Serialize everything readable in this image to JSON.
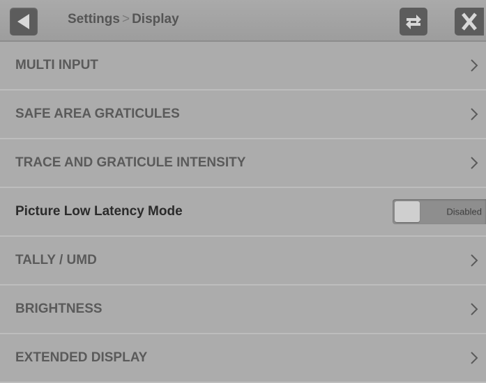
{
  "header": {
    "breadcrumb_parent": "Settings",
    "breadcrumb_separator": ">",
    "breadcrumb_current": "Display",
    "back_icon": "back-arrow-icon",
    "swap_icon": "swap-arrows-icon",
    "close_icon": "close-x-icon"
  },
  "menu": {
    "items": [
      {
        "label": "MULTI INPUT",
        "type": "submenu"
      },
      {
        "label": "SAFE AREA GRATICULES",
        "type": "submenu"
      },
      {
        "label": "TRACE AND GRATICULE INTENSITY",
        "type": "submenu"
      },
      {
        "label": "Picture Low Latency Mode",
        "type": "toggle",
        "state": "Disabled"
      },
      {
        "label": "TALLY / UMD",
        "type": "submenu"
      },
      {
        "label": "BRIGHTNESS",
        "type": "submenu"
      },
      {
        "label": "EXTENDED DISPLAY",
        "type": "submenu"
      }
    ]
  },
  "colors": {
    "background": "#acacac",
    "button": "#5c5c5c",
    "text": "#5a5a5a"
  }
}
